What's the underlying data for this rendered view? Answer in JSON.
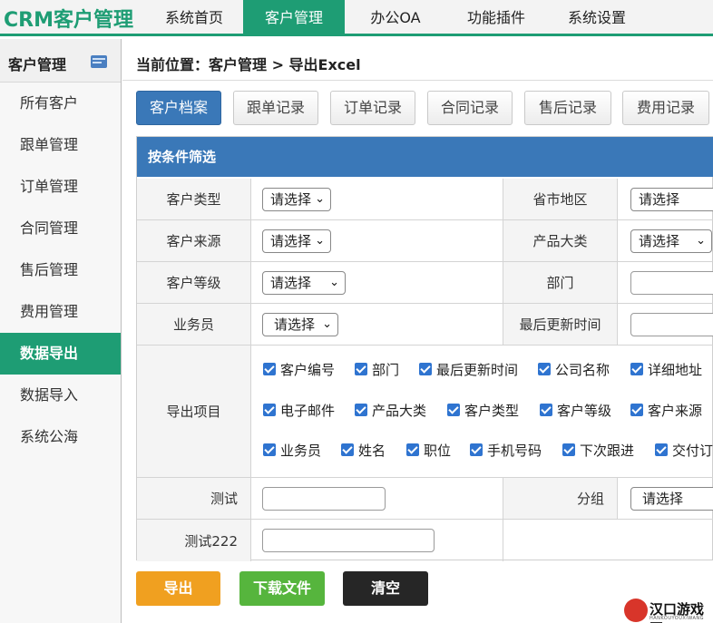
{
  "app": {
    "logo": "CRM客户管理"
  },
  "nav": {
    "tabs": [
      "系统首页",
      "客户管理",
      "办公OA",
      "功能插件",
      "系统设置"
    ],
    "active_index": 1
  },
  "sidebar": {
    "title": "客户管理",
    "items": [
      "所有客户",
      "跟单管理",
      "订单管理",
      "合同管理",
      "售后管理",
      "费用管理",
      "数据导出",
      "数据导入",
      "系统公海"
    ],
    "active_index": 6
  },
  "breadcrumb": "当前位置：客户管理 > 导出Excel",
  "subtabs": {
    "items": [
      "客户档案",
      "跟单记录",
      "订单记录",
      "合同记录",
      "售后记录",
      "费用记录"
    ],
    "active_index": 0
  },
  "filter": {
    "title": "按条件筛选",
    "labels": {
      "customer_type": "客户类型",
      "region": "省市地区",
      "customer_source": "客户来源",
      "product_category": "产品大类",
      "customer_level": "客户等级",
      "department": "部门",
      "salesperson": "业务员",
      "last_update": "最后更新时间",
      "export_items": "导出项目",
      "test": "测试",
      "group": "分组",
      "test222": "测试222"
    },
    "select_placeholder": "请选择",
    "export_fields": [
      [
        "客户编号",
        "部门",
        "最后更新时间",
        "公司名称",
        "详细地址"
      ],
      [
        "电子邮件",
        "产品大类",
        "客户类型",
        "客户等级",
        "客户来源"
      ],
      [
        "业务员",
        "姓名",
        "职位",
        "手机号码",
        "下次跟进",
        "交付订"
      ]
    ]
  },
  "actions": {
    "export": "导出",
    "download": "下载文件",
    "clear": "清空"
  },
  "watermark": {
    "text": "汉口游戏网",
    "sub": "HANKOUYOUXIWANG"
  },
  "colors": {
    "brand": "#1e9d74",
    "blue": "#3a78b8",
    "orange": "#f0a020",
    "green": "#56b53d",
    "dark": "#262626"
  }
}
